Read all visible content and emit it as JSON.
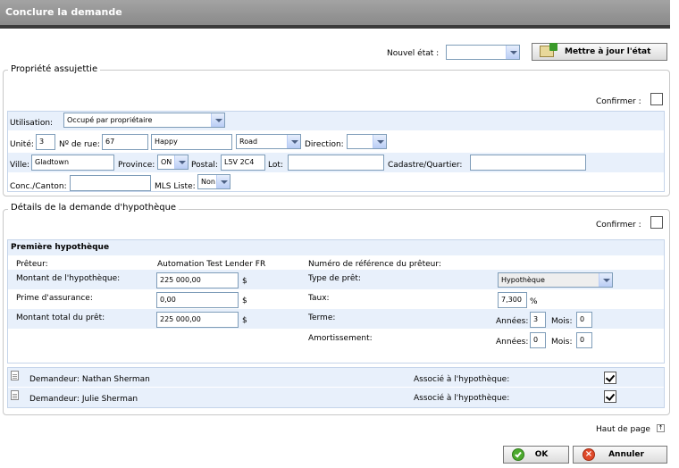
{
  "header": {
    "title": "Conclure la demande"
  },
  "status_bar": {
    "new_state_label": "Nouvel état :",
    "new_state_value": "",
    "update_button": "Mettre à jour l'état"
  },
  "property": {
    "legend": "Propriété assujettie",
    "confirm_label": "Confirmer :",
    "usage_label": "Utilisation:",
    "usage_value": "Occupé par propriétaire",
    "unit_label": "Unité:",
    "unit_value": "3",
    "street_no_label": "Nº de rue:",
    "street_no_value": "67",
    "street_name_value": "Happy",
    "street_type_value": "Road",
    "direction_label": "Direction:",
    "direction_value": "",
    "city_label": "Ville:",
    "city_value": "Gladtown",
    "province_label": "Province:",
    "province_value": "ON",
    "postal_label": "Postal:",
    "postal_value": "L5V 2C4",
    "lot_label": "Lot:",
    "lot_value": "",
    "cadastre_label": "Cadastre/Quartier:",
    "cadastre_value": "",
    "conc_label": "Conc./Canton:",
    "conc_value": "",
    "mls_label": "MLS Liste:",
    "mls_value": "Non"
  },
  "mortgage": {
    "legend": "Détails de la demande d'hypothèque",
    "confirm_label": "Confirmer :",
    "section_title": "Première hypothèque",
    "lender_label": "Prêteur:",
    "lender_value": "Automation Test Lender FR",
    "lender_ref_label": "Numéro de référence du prêteur:",
    "amount_label": "Montant de l'hypothèque:",
    "amount_value": "225 000,00",
    "currency": "$",
    "loan_type_label": "Type de prêt:",
    "loan_type_value": "Hypothèque",
    "insurance_label": "Prime d'assurance:",
    "insurance_value": "0,00",
    "rate_label": "Taux:",
    "rate_value": "7,300",
    "percent": "%",
    "total_label": "Montant total du prêt:",
    "total_value": "225 000,00",
    "term_label": "Terme:",
    "years_label": "Années:",
    "term_years": "3",
    "months_label": "Mois:",
    "term_months": "0",
    "amort_label": "Amortissement:",
    "amort_years": "0",
    "amort_months": "0"
  },
  "applicants": [
    {
      "label": "Demandeur: Nathan Sherman",
      "assoc_label": "Associé à l'hypothèque:",
      "checked": true
    },
    {
      "label": "Demandeur: Julie Sherman",
      "assoc_label": "Associé à l'hypothèque:",
      "checked": true
    }
  ],
  "footer": {
    "top_link": "Haut de page",
    "ok_button": "OK",
    "cancel_button": "Annuler"
  }
}
